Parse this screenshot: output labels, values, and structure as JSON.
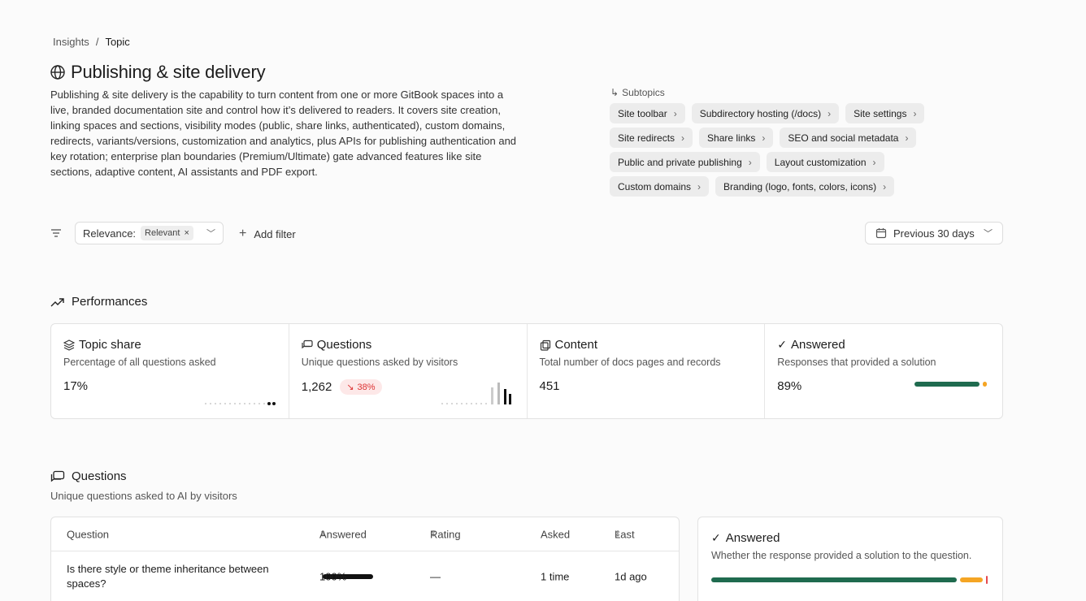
{
  "breadcrumb": {
    "parent": "Insights",
    "sep": "/",
    "current": "Topic"
  },
  "page": {
    "title": "Publishing & site delivery",
    "description": "Publishing & site delivery is the capability to turn content from one or more GitBook spaces into a live, branded documentation site and control how it’s delivered to readers. It covers site creation, linking spaces and sections, visibility modes (public, share links, authenticated), custom domains, redirects, variants/versions, customization and analytics, plus APIs for publishing authentication and key rotation; enterprise plan boundaries (Premium/Ultimate) gate advanced features like site sections, adaptive content, AI assistants and PDF export."
  },
  "subtopics": {
    "label": "Subtopics",
    "rows": [
      [
        "Site toolbar",
        "Subdirectory hosting (/docs)",
        "Site settings"
      ],
      [
        "Site redirects",
        "Share links",
        "SEO and social metadata"
      ],
      [
        "Public and private publishing",
        "Layout customization"
      ],
      [
        "Custom domains",
        "Branding (logo, fonts, colors, icons)"
      ]
    ]
  },
  "filters": {
    "relevance_label": "Relevance:",
    "relevance_value": "Relevant",
    "add_filter": "Add filter",
    "date_range": "Previous 30 days"
  },
  "performances": {
    "title": "Performances",
    "metrics": [
      {
        "title": "Topic share",
        "subtitle": "Percentage of all questions asked",
        "value": "17%"
      },
      {
        "title": "Questions",
        "subtitle": "Unique questions asked by visitors",
        "value": "1,262",
        "delta": "38%"
      },
      {
        "title": "Content",
        "subtitle": "Total number of docs pages and records",
        "value": "451"
      },
      {
        "title": "Answered",
        "subtitle": "Responses that provided a solution",
        "value": "89%",
        "answered_fraction": 0.89
      }
    ]
  },
  "questions": {
    "title": "Questions",
    "subtitle": "Unique questions asked to AI by visitors",
    "columns": {
      "question": "Question",
      "answered": "Answered",
      "rating": "Rating",
      "asked": "Asked",
      "last": "Last"
    },
    "rows": [
      {
        "question": "Is there style or theme inheritance between spaces?",
        "answered": "100%",
        "answered_fraction": 1.0,
        "rating": "—",
        "asked": "1 time",
        "last": "1d ago"
      }
    ]
  },
  "answered_panel": {
    "title": "Answered",
    "subtitle": "Whether the response provided a solution to the question."
  },
  "colors": {
    "success": "#1f6b4f",
    "warning": "#f5a524",
    "danger": "#e5484d",
    "chip_bg": "#ececec"
  }
}
